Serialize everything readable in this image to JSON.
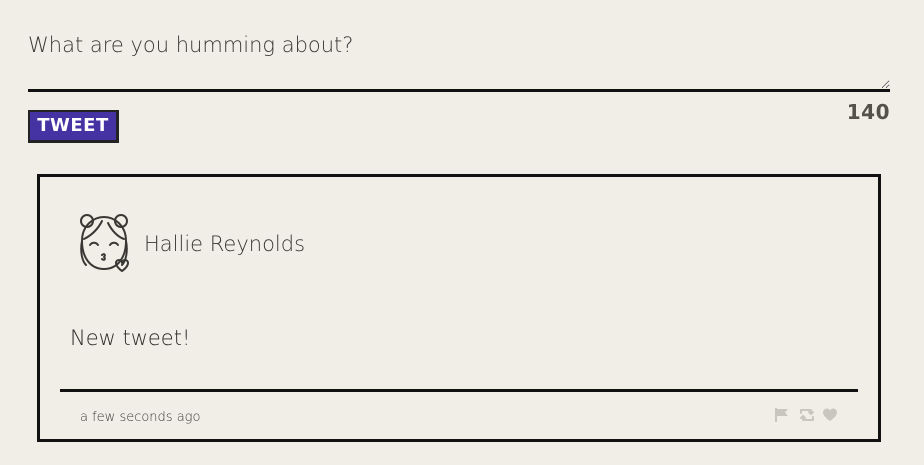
{
  "compose": {
    "placeholder": "What are you humming about?",
    "counter": "140",
    "tweet_button_label": "TWEET"
  },
  "colors": {
    "background": "#f1eee8",
    "button_bg": "#4532a3",
    "border": "#111111",
    "icon_muted": "#c9c6c0"
  },
  "tweet": {
    "avatar_icon": "girl-kiss-avatar-icon",
    "author": "Hallie Reynolds",
    "body": "New tweet!",
    "timestamp": "a few seconds ago",
    "actions": [
      "flag-icon",
      "retweet-icon",
      "heart-icon"
    ]
  }
}
